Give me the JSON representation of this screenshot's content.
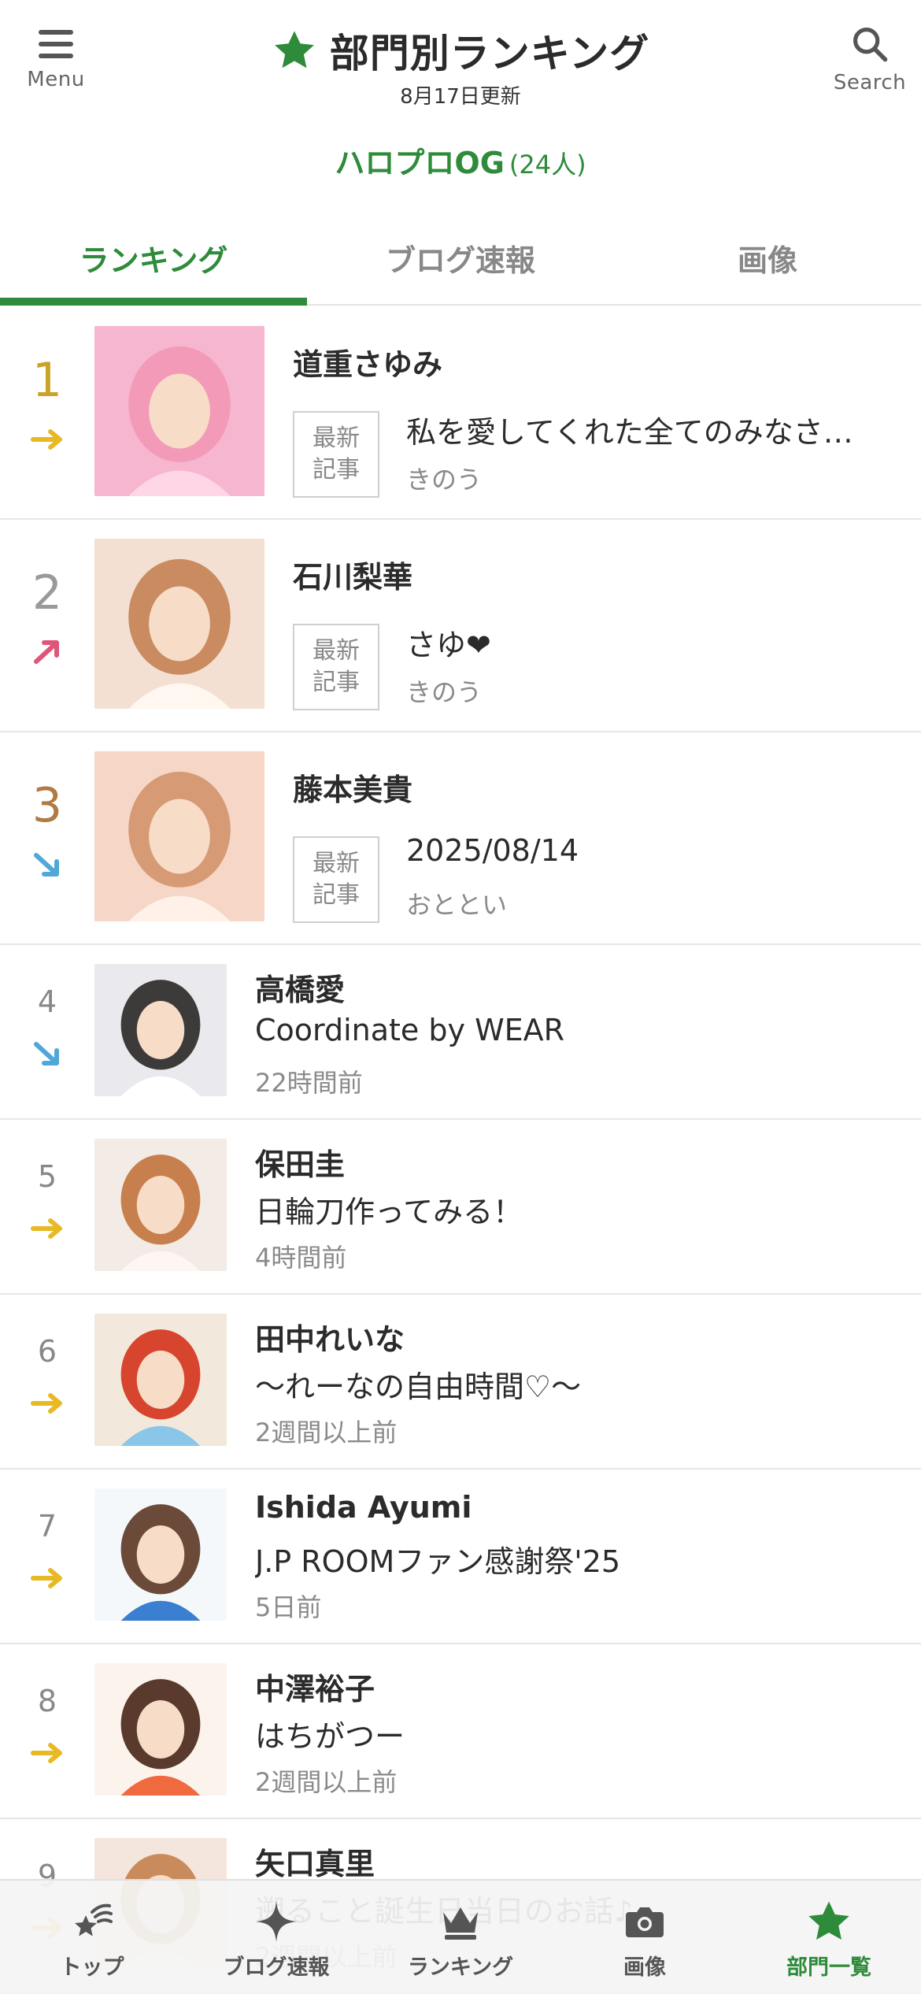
{
  "header": {
    "menu_label": "Menu",
    "search_label": "Search",
    "title": "部門別ランキング",
    "updated": "8月17日更新",
    "accent_color": "#2e8b3a"
  },
  "group": {
    "name": "ハロプロOG",
    "count": "(24人)"
  },
  "tabs": [
    {
      "label": "ランキング",
      "active": true
    },
    {
      "label": "ブログ速報",
      "active": false
    },
    {
      "label": "画像",
      "active": false
    }
  ],
  "badge": {
    "line1": "最新",
    "line2": "記事"
  },
  "rankings": [
    {
      "rank": "1",
      "trend": "flat",
      "name": "道重さゆみ",
      "post": "私を愛してくれた全てのみなさ…",
      "time": "きのう"
    },
    {
      "rank": "2",
      "trend": "up",
      "name": "石川梨華",
      "post": "さゆ❤",
      "time": "きのう"
    },
    {
      "rank": "3",
      "trend": "down",
      "name": "藤本美貴",
      "post": "2025/08/14",
      "time": "おととい"
    },
    {
      "rank": "4",
      "trend": "down",
      "name": "高橋愛",
      "post": "Coordinate by WEAR",
      "time": "22時間前"
    },
    {
      "rank": "5",
      "trend": "flat",
      "name": "保田圭",
      "post": "日輪刀作ってみる！",
      "time": "4時間前"
    },
    {
      "rank": "6",
      "trend": "flat",
      "name": "田中れいな",
      "post": "〜れーなの自由時間♡〜",
      "time": "2週間以上前"
    },
    {
      "rank": "7",
      "trend": "flat",
      "name": "Ishida Ayumi",
      "post": "J.P ROOMファン感謝祭'25",
      "time": "5日前"
    },
    {
      "rank": "8",
      "trend": "flat",
      "name": "中澤裕子",
      "post": "はちがつー",
      "time": "2週間以上前"
    },
    {
      "rank": "9",
      "trend": "flat",
      "name": "矢口真里",
      "post": "遡ること誕生日当日のお話♪",
      "time": "2週間以上前"
    }
  ],
  "trend_colors": {
    "flat": "#e8b923",
    "up": "#e0557a",
    "down": "#4fa8d8"
  },
  "bottom_nav": [
    {
      "label": "トップ",
      "icon": "top-star-icon",
      "active": false
    },
    {
      "label": "ブログ速報",
      "icon": "sparkle-icon",
      "active": false
    },
    {
      "label": "ランキング",
      "icon": "crown-icon",
      "active": false
    },
    {
      "label": "画像",
      "icon": "camera-icon",
      "active": false
    },
    {
      "label": "部門一覧",
      "icon": "star-icon",
      "active": true
    }
  ]
}
